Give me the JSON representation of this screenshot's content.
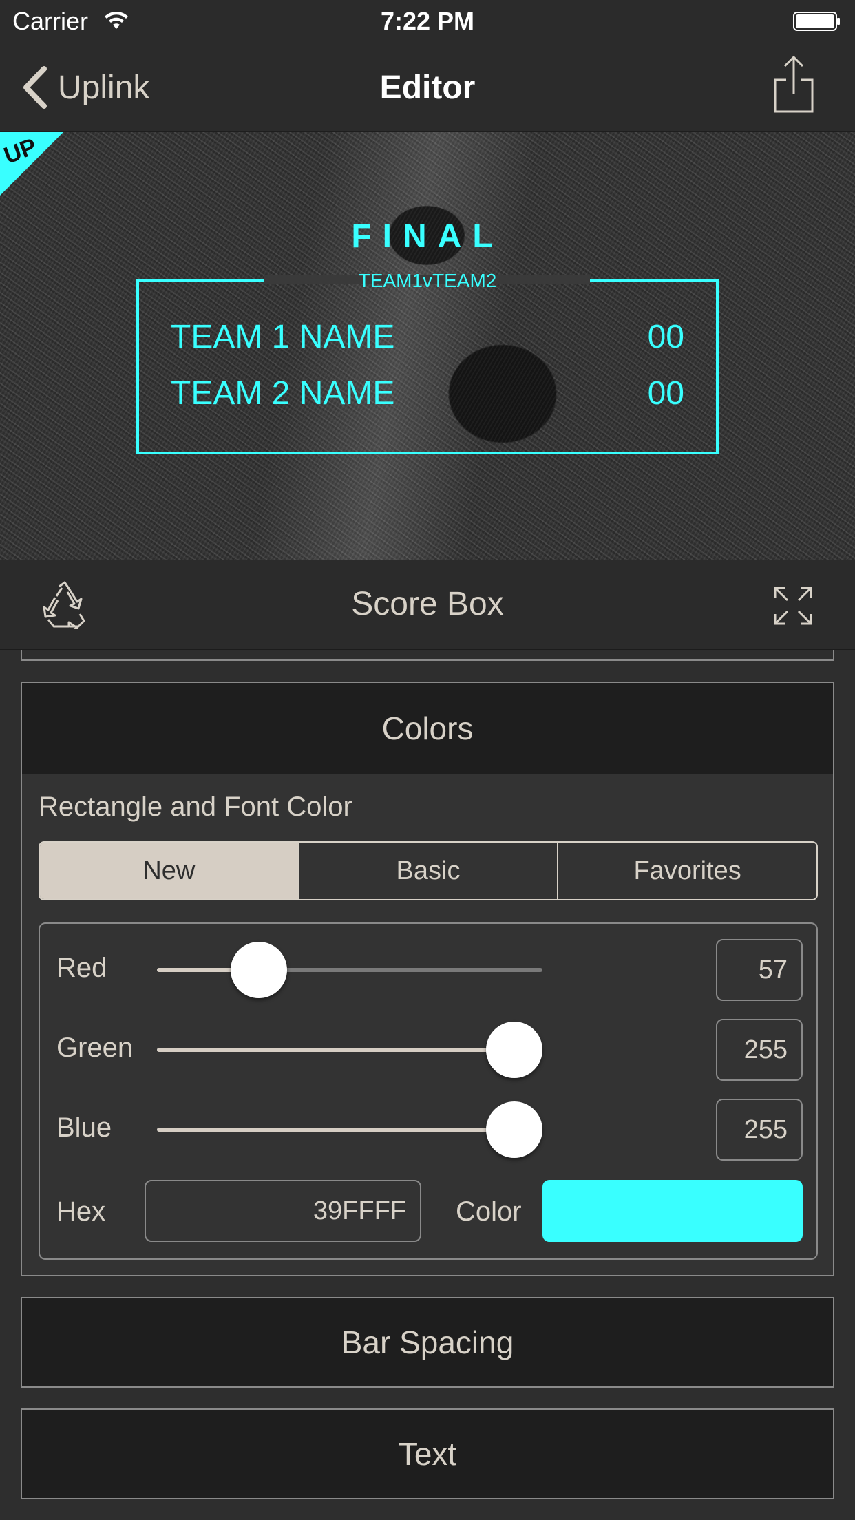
{
  "status_bar": {
    "carrier": "Carrier",
    "time": "7:22 PM"
  },
  "nav": {
    "back_label": "Uplink",
    "title": "Editor",
    "back_icon": "chevron-left-icon",
    "share_icon": "share-icon"
  },
  "preview": {
    "logo_text": "UP",
    "title": "FINAL",
    "matchup": "TEAM1vTEAM2",
    "teams": [
      {
        "name": "TEAM 1 NAME",
        "score": "00"
      },
      {
        "name": "TEAM 2 NAME",
        "score": "00"
      }
    ],
    "accent": "#39FFFF"
  },
  "toolbar": {
    "title": "Score Box",
    "left_icon": "recycle-icon",
    "right_icon": "expand-icon"
  },
  "colors_panel": {
    "header": "Colors",
    "section_label": "Rectangle and Font Color",
    "segments": [
      "New",
      "Basic",
      "Favorites"
    ],
    "selected_segment": "New",
    "sliders": [
      {
        "label": "Red",
        "value": "57",
        "fraction": 0.224
      },
      {
        "label": "Green",
        "value": "255",
        "fraction": 1.0
      },
      {
        "label": "Blue",
        "value": "255",
        "fraction": 1.0
      }
    ],
    "hex_label": "Hex",
    "hex_value": "39FFFF",
    "color_label": "Color",
    "color_value": "#39FFFF"
  },
  "panels": {
    "bar_spacing": "Bar Spacing",
    "text": "Text"
  }
}
